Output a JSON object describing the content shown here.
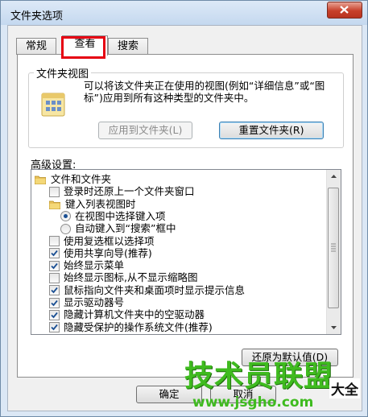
{
  "window": {
    "title": "文件夹选项"
  },
  "tabs": [
    {
      "label": "常规"
    },
    {
      "label": "查看"
    },
    {
      "label": "搜索"
    }
  ],
  "folder_views": {
    "title": "文件夹视图",
    "description": "可以将该文件夹正在使用的视图(例如“详细信息”或“图标”)应用到所有这种类型的文件夹中。",
    "apply_button": "应用到文件夹(L)",
    "reset_button": "重置文件夹(R)"
  },
  "advanced": {
    "label": "高级设置:",
    "items": [
      {
        "text": "文件和文件夹",
        "kind": "folder",
        "level": 0
      },
      {
        "text": "登录时还原上一个文件夹窗口",
        "kind": "checkbox",
        "checked": false,
        "level": 1
      },
      {
        "text": "键入列表视图时",
        "kind": "folder",
        "level": 1
      },
      {
        "text": "在视图中选择键入项",
        "kind": "radio",
        "checked": true,
        "level": 2
      },
      {
        "text": "自动键入到“搜索”框中",
        "kind": "radio",
        "checked": false,
        "level": 2
      },
      {
        "text": "使用复选框以选择项",
        "kind": "checkbox",
        "checked": false,
        "level": 1
      },
      {
        "text": "使用共享向导(推荐)",
        "kind": "checkbox",
        "checked": true,
        "level": 1
      },
      {
        "text": "始终显示菜单",
        "kind": "checkbox",
        "checked": true,
        "level": 1
      },
      {
        "text": "始终显示图标,从不显示缩略图",
        "kind": "checkbox",
        "checked": false,
        "level": 1
      },
      {
        "text": "鼠标指向文件夹和桌面项时显示提示信息",
        "kind": "checkbox",
        "checked": true,
        "level": 1
      },
      {
        "text": "显示驱动器号",
        "kind": "checkbox",
        "checked": true,
        "level": 1
      },
      {
        "text": "隐藏计算机文件夹中的空驱动器",
        "kind": "checkbox",
        "checked": true,
        "level": 1
      },
      {
        "text": "隐藏受保护的操作系统文件(推荐)",
        "kind": "checkbox",
        "checked": true,
        "level": 1
      }
    ],
    "restore_button": "还原为默认值(D)"
  },
  "footer": {
    "ok_button": "确定",
    "cancel_button": "取消"
  },
  "watermark": {
    "big": "技术员联盟",
    "small": "www.jsgho.com",
    "suffix": "大全"
  },
  "colors": {
    "highlight": "#e60012",
    "watermark": "#3fbb1f",
    "checkmark": "#1a4f93"
  }
}
